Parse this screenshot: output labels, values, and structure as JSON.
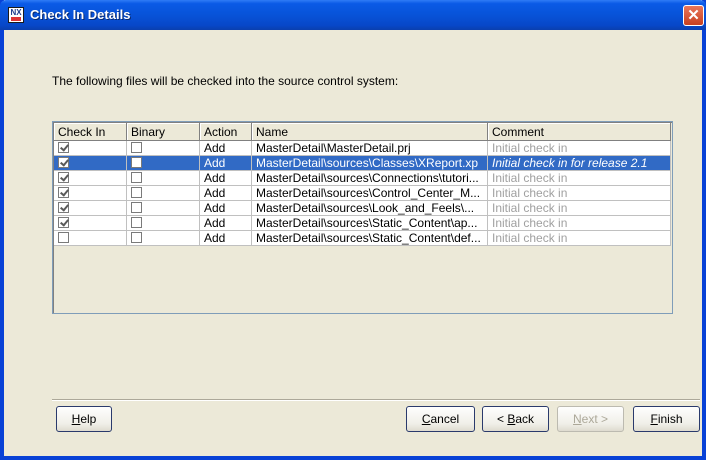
{
  "window": {
    "title": "Check In Details",
    "icon_text": "NX"
  },
  "instruction": "The following files will be checked into the source control system:",
  "table": {
    "columns": [
      "Check In",
      "Binary",
      "Action",
      "Name",
      "Comment"
    ],
    "rows": [
      {
        "check_in": true,
        "binary": false,
        "action": "Add",
        "name": "MasterDetail\\MasterDetail.prj",
        "comment": "Initial check in",
        "selected": false
      },
      {
        "check_in": true,
        "binary": false,
        "action": "Add",
        "name": "MasterDetail\\sources\\Classes\\XReport.xp",
        "comment": "Initial check in for release 2.1",
        "selected": true
      },
      {
        "check_in": true,
        "binary": false,
        "action": "Add",
        "name": "MasterDetail\\sources\\Connections\\tutori...",
        "comment": "Initial check in",
        "selected": false
      },
      {
        "check_in": true,
        "binary": false,
        "action": "Add",
        "name": "MasterDetail\\sources\\Control_Center_M...",
        "comment": "Initial check in",
        "selected": false
      },
      {
        "check_in": true,
        "binary": false,
        "action": "Add",
        "name": "MasterDetail\\sources\\Look_and_Feels\\...",
        "comment": "Initial check in",
        "selected": false
      },
      {
        "check_in": true,
        "binary": false,
        "action": "Add",
        "name": "MasterDetail\\sources\\Static_Content\\ap...",
        "comment": "Initial check in",
        "selected": false
      },
      {
        "check_in": false,
        "binary": false,
        "action": "Add",
        "name": "MasterDetail\\sources\\Static_Content\\def...",
        "comment": "Initial check in",
        "selected": false
      }
    ]
  },
  "buttons": {
    "help": {
      "mnemonic": "H",
      "rest": "elp"
    },
    "cancel": {
      "mnemonic": "C",
      "rest": "ancel"
    },
    "back": {
      "prefix": "< ",
      "mnemonic": "B",
      "rest": "ack"
    },
    "next": {
      "mnemonic": "N",
      "rest": "ext >",
      "enabled": false
    },
    "finish": {
      "mnemonic": "F",
      "rest": "inish"
    }
  },
  "colors": {
    "titlebar": "#0853d8",
    "selection": "#316ac5",
    "dialog_bg": "#ece9d8",
    "comment_text": "#a0a0a0"
  }
}
